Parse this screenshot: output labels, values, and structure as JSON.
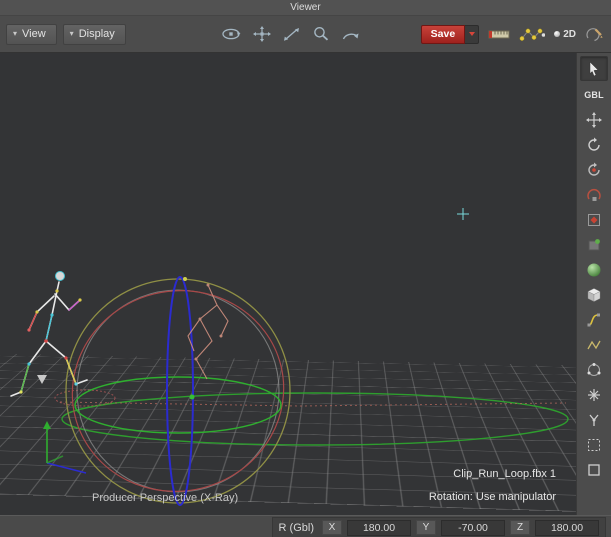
{
  "window": {
    "title": "Viewer"
  },
  "menus": {
    "view_label": "View",
    "display_label": "Display"
  },
  "toolbar": {
    "save_label": "Save",
    "twod_label": "2D"
  },
  "sidebar": {
    "gbl_label": "GBL"
  },
  "viewport": {
    "camera_label": "Producer Perspective (X-Ray)",
    "clip_label": "Clip_Run_Loop.fbx 1",
    "mode_label": "Rotation: Use manipulator"
  },
  "statusbar": {
    "mode_label": "R (Gbl)",
    "axes": [
      {
        "label": "X",
        "value": "180.00"
      },
      {
        "label": "Y",
        "value": "-70.00"
      },
      {
        "label": "Z",
        "value": "180.00"
      }
    ]
  },
  "colors": {
    "save_button": "#b22a24",
    "trajectory_green": "#2ea82e",
    "ring_outer": "#8f8f45",
    "ring_red": "#a84848",
    "ring_green": "#2fae2f",
    "ring_blue": "#2b2bd0",
    "ghost_skeleton": "#cf8f7f",
    "grid_line": "#a0a0a0"
  }
}
